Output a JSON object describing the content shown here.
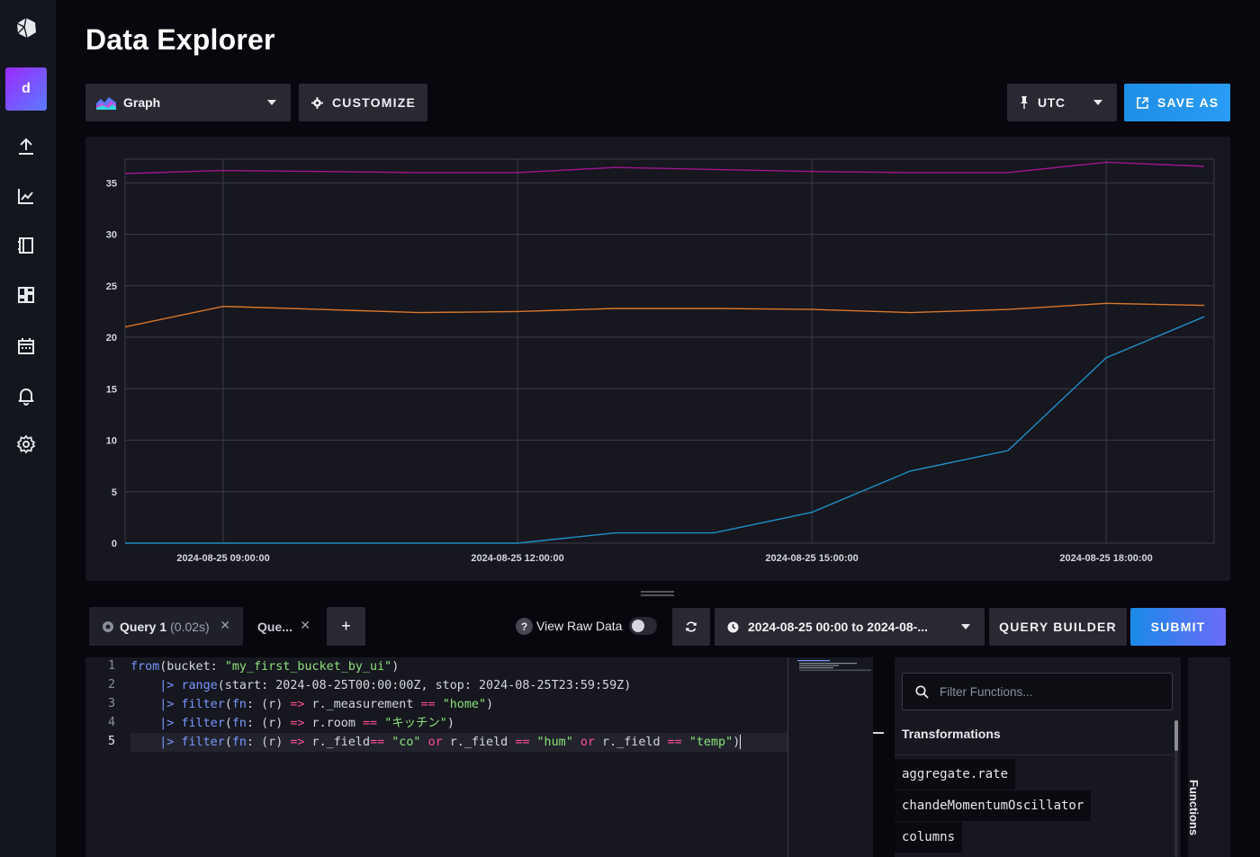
{
  "sidebar": {
    "org_initial": "d",
    "icons": [
      "upload-icon",
      "chart-icon",
      "notebook-icon",
      "dashboards-icon",
      "calendar-icon",
      "bell-icon",
      "gear-icon"
    ]
  },
  "header": {
    "title": "Data Explorer"
  },
  "toolbar": {
    "view_type": "Graph",
    "customize_label": "CUSTOMIZE",
    "timezone_label": "UTC",
    "save_as_label": "SAVE AS"
  },
  "chart_data": {
    "type": "line",
    "title": "",
    "xlabel": "",
    "ylabel": "",
    "x_ticks": [
      "2024-08-25 09:00:00",
      "2024-08-25 12:00:00",
      "2024-08-25 15:00:00",
      "2024-08-25 18:00:00"
    ],
    "y_ticks": [
      0,
      5,
      10,
      15,
      20,
      25,
      30,
      35
    ],
    "ylim": [
      0,
      37.3
    ],
    "xlim_hours": [
      8,
      19.1
    ],
    "grid": true,
    "colors": {
      "purple": "#a0158f",
      "orange": "#d9772b",
      "blue": "#1f8fc9",
      "grid": "#3a3b45"
    },
    "x_hours": [
      8,
      9,
      10,
      11,
      12,
      13,
      14,
      15,
      16,
      17,
      18,
      19
    ],
    "series": [
      {
        "color": "purple",
        "values": [
          35.9,
          36.2,
          36.1,
          36.0,
          36.0,
          36.5,
          36.3,
          36.1,
          36.0,
          36.0,
          37.0,
          36.6
        ]
      },
      {
        "color": "orange",
        "values": [
          21.0,
          23.0,
          22.7,
          22.4,
          22.5,
          22.8,
          22.8,
          22.7,
          22.4,
          22.7,
          23.3,
          23.1
        ]
      },
      {
        "color": "blue",
        "values": [
          0,
          0,
          0,
          0,
          0,
          1,
          1,
          3,
          7,
          9,
          18,
          22
        ]
      }
    ]
  },
  "query_bar": {
    "tabs": [
      {
        "name": "Query 1",
        "duration": "(0.02s)"
      },
      {
        "name": "Que..."
      }
    ],
    "add_label": "+",
    "view_raw_label": "View Raw Data",
    "view_raw_enabled": false,
    "time_range": "2024-08-25 00:00 to 2024-08-...",
    "query_builder_label": "QUERY BUILDER",
    "submit_label": "SUBMIT"
  },
  "editor": {
    "line_numbers": [
      "1",
      "2",
      "3",
      "4",
      "5"
    ],
    "lines": [
      "from(bucket: \"my_first_bucket_by_ui\")",
      "    |> range(start: 2024-08-25T00:00:00Z, stop: 2024-08-25T23:59:59Z)",
      "    |> filter(fn: (r) => r._measurement == \"home\")",
      "    |> filter(fn: (r) => r.room == \"キッチン\")",
      "    |> filter(fn: (r) => r._field== \"co\" or r._field == \"hum\" or r._field == \"temp\")"
    ]
  },
  "functions_panel": {
    "search_placeholder": "Filter Functions...",
    "heading": "Transformations",
    "items": [
      "aggregate.rate",
      "chandeMomentumOscillator",
      "columns"
    ],
    "tab_label": "Functions"
  }
}
